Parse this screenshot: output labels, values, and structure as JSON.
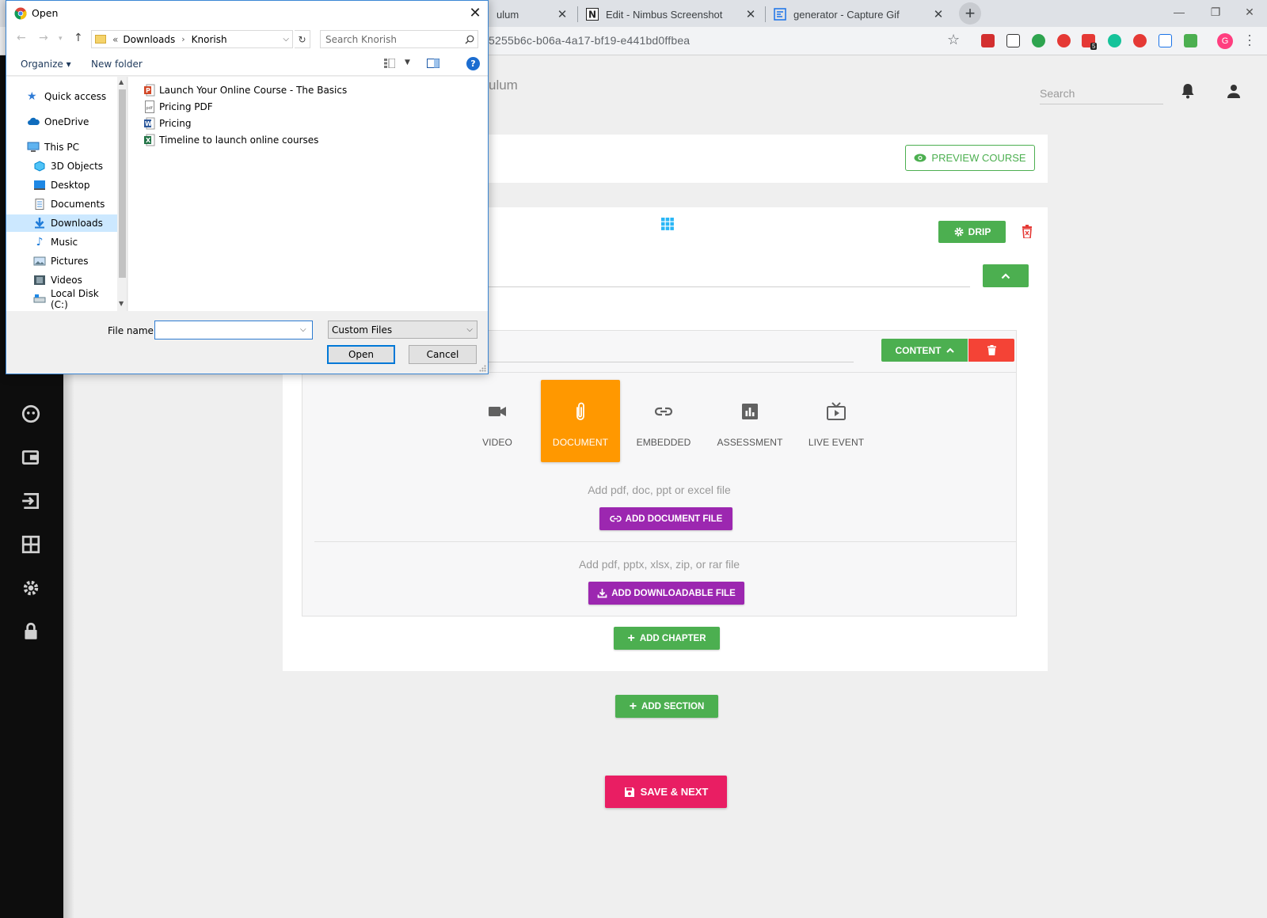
{
  "browser": {
    "tabs": [
      {
        "title": "ulum"
      },
      {
        "title": "Edit - Nimbus Screenshot"
      },
      {
        "title": "generator - Capture Gif"
      }
    ],
    "url_partial": "5255b6c-b06a-4a17-bf19-e441bd0ffbea",
    "profile_initial": "G",
    "ext_badge": "5",
    "new_tab_icon": "plus-icon",
    "colors": {
      "tabstrip": "#dee1e6",
      "toolbar": "#f2f3f5"
    }
  },
  "app": {
    "title_partial": "ulum",
    "search_placeholder": "Search",
    "preview_label": "PREVIEW COURSE",
    "drip_label": "DRIP",
    "content_label": "CONTENT",
    "content_types": [
      {
        "label": "VIDEO",
        "icon": "videocam-icon"
      },
      {
        "label": "DOCUMENT",
        "icon": "paperclip-icon",
        "active": true
      },
      {
        "label": "EMBEDDED",
        "icon": "link-icon"
      },
      {
        "label": "ASSESSMENT",
        "icon": "bar-chart-icon"
      },
      {
        "label": "LIVE EVENT",
        "icon": "tv-icon"
      }
    ],
    "document_hint": "Add pdf, doc, ppt or excel file",
    "add_document_label": "ADD DOCUMENT FILE",
    "downloadable_hint": "Add pdf, pptx, xlsx, zip, or rar file",
    "add_downloadable_label": "ADD DOWNLOADABLE FILE",
    "add_chapter_label": "ADD CHAPTER",
    "add_section_label": "ADD SECTION",
    "save_next_label": "SAVE & NEXT",
    "colors": {
      "green": "#4caf50",
      "orange": "#ff9800",
      "purple": "#9c27b0",
      "pink": "#e91e63",
      "red": "#f44336",
      "sidebar": "#0d0d0d"
    }
  },
  "dialog": {
    "title": "Open",
    "address": {
      "prefix": "«",
      "crumbs": [
        "Downloads",
        "Knorish"
      ]
    },
    "search_placeholder": "Search Knorish",
    "organize_label": "Organize ▾",
    "new_folder_label": "New folder",
    "help_label": "?",
    "nav_items": [
      {
        "label": "Quick access",
        "icon": "star-icon"
      },
      {
        "label": "OneDrive",
        "icon": "cloud-icon"
      },
      {
        "label": "This PC",
        "icon": "computer-icon"
      },
      {
        "label": "3D Objects",
        "icon": "cube-icon"
      },
      {
        "label": "Desktop",
        "icon": "desktop-icon"
      },
      {
        "label": "Documents",
        "icon": "document-icon"
      },
      {
        "label": "Downloads",
        "icon": "download-icon",
        "selected": true
      },
      {
        "label": "Music",
        "icon": "music-icon"
      },
      {
        "label": "Pictures",
        "icon": "picture-icon"
      },
      {
        "label": "Videos",
        "icon": "film-icon"
      },
      {
        "label": "Local Disk (C:)",
        "icon": "drive-icon"
      }
    ],
    "files": [
      {
        "name": "Launch Your Online Course - The Basics",
        "icon": "powerpoint-icon"
      },
      {
        "name": "Pricing PDF",
        "icon": "pdf-icon"
      },
      {
        "name": "Pricing",
        "icon": "word-icon"
      },
      {
        "name": "Timeline to launch online courses",
        "icon": "excel-icon"
      }
    ],
    "file_name_label": "File name:",
    "file_name_value": "",
    "filter_value": "Custom Files",
    "open_label": "Open",
    "cancel_label": "Cancel",
    "colors": {
      "selection": "#cce8ff",
      "accent": "#0078d7"
    }
  }
}
